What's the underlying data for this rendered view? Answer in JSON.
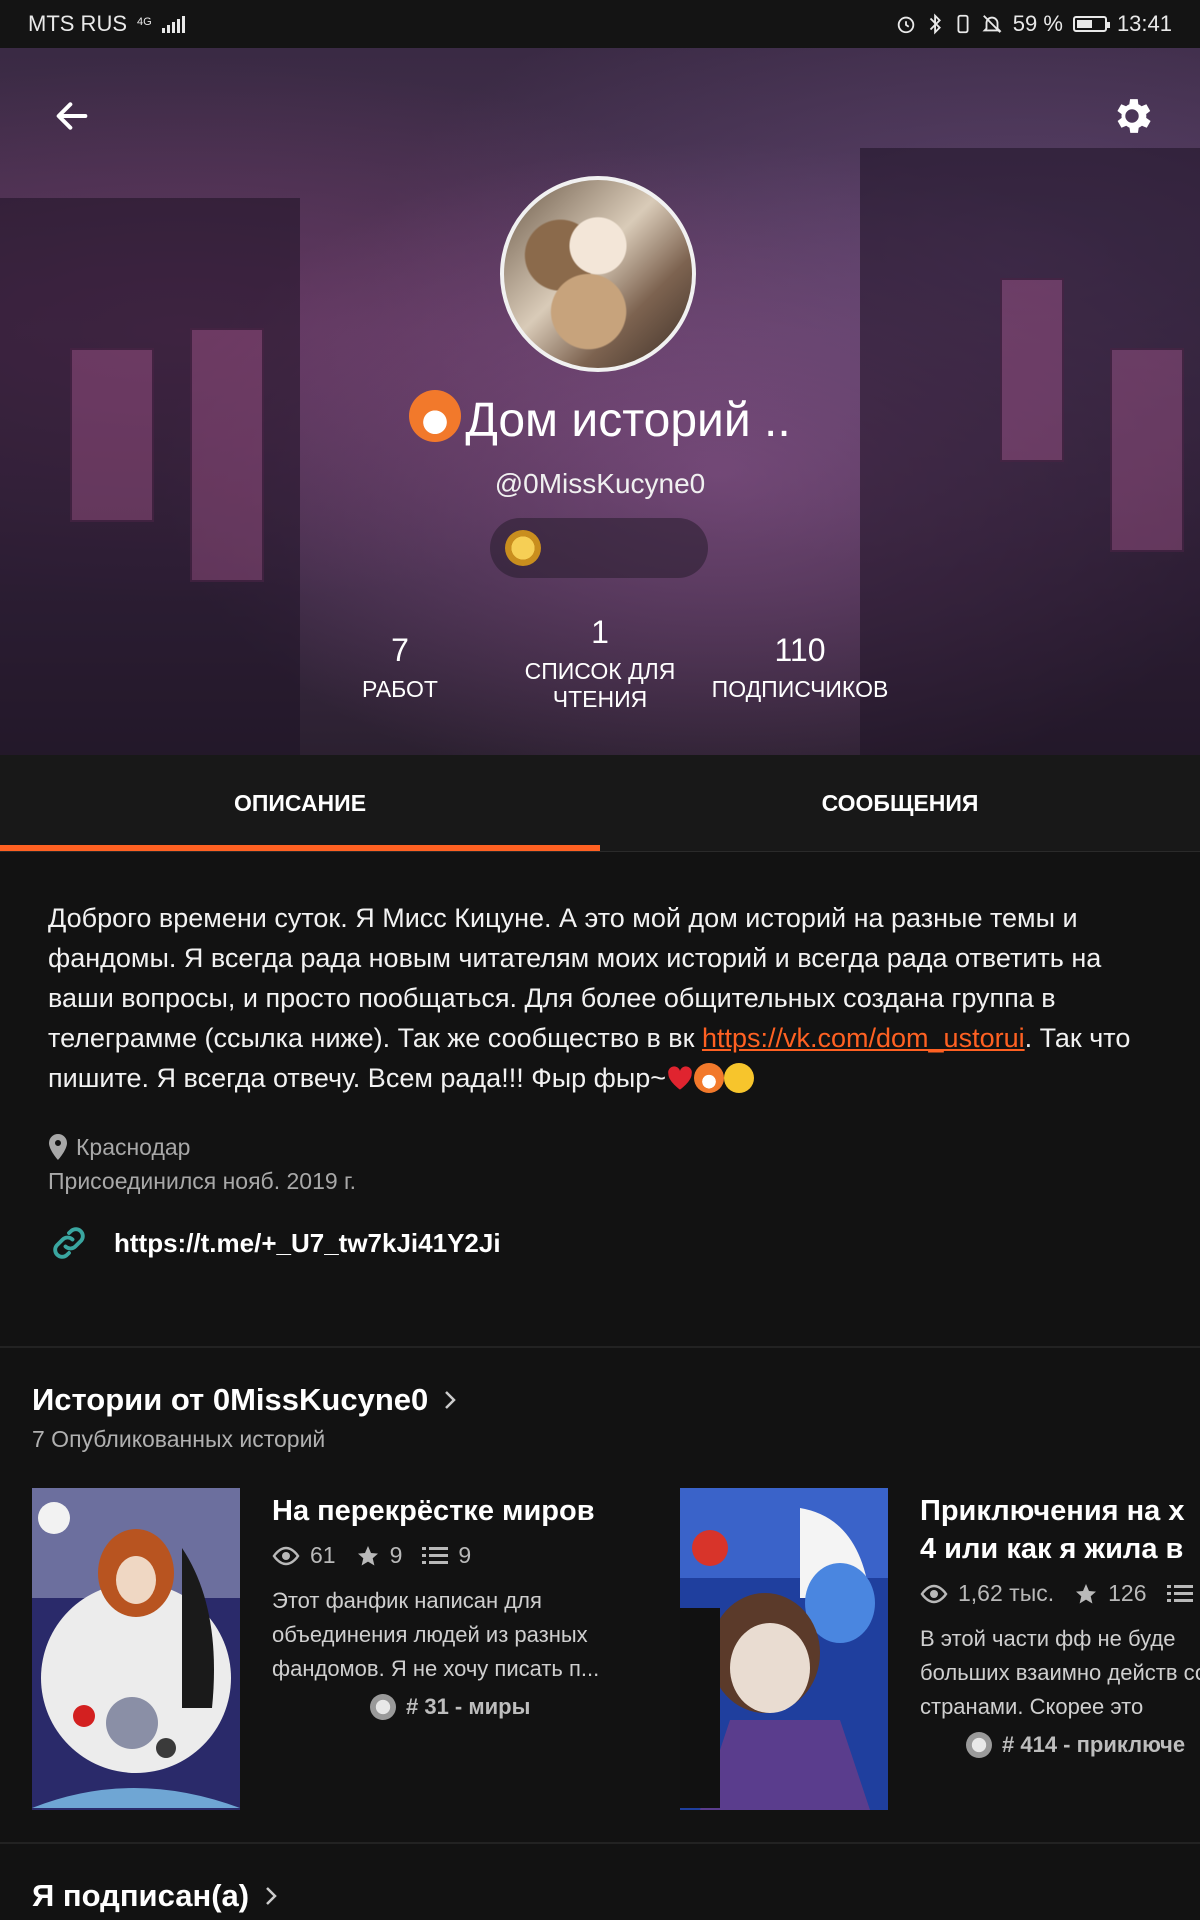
{
  "status_bar": {
    "carrier": "MTS RUS",
    "network": "4G",
    "battery": "59 %",
    "battery_level": 0.59,
    "time": "13:41"
  },
  "profile": {
    "display_name": "Дом историй ..",
    "username": "@0MissKucyne0",
    "stats": [
      {
        "value": "7",
        "label": "РАБОТ"
      },
      {
        "value": "1",
        "label": "СПИСОК ДЛЯ ЧТЕНИЯ"
      },
      {
        "value": "110",
        "label": "ПОДПИСЧИКОВ"
      }
    ]
  },
  "tabs": [
    {
      "label": "ОПИСАНИЕ",
      "active": true
    },
    {
      "label": "СООБЩЕНИЯ",
      "active": false
    }
  ],
  "about": {
    "text_before_link": "Доброго времени суток. Я Мисс Кицуне. А это мой дом историй на разные темы и фандомы. Я всегда рада новым читателям моих историй и всегда рада ответить на ваши вопросы, и просто пообщаться. Для более общительных создана группа в телеграмме (ссылка ниже). Так же сообщество в вк ",
    "link": "https://vk.com/dom_ustorui",
    "text_after_link": ". Так что пишите. Я всегда отвечу. Всем рада!!! Фыр фыр~",
    "location": "Краснодар",
    "joined": "Присоединился нояб. 2019 г.",
    "external_link": "https://t.me/+_U7_tw7kJi41Y2Ji"
  },
  "stories_section": {
    "title": "Истории от 0MissKucyne0",
    "subtitle": "7 Опубликованных историй",
    "stories": [
      {
        "title": "На перекрёстке миров",
        "reads": "61",
        "votes": "9",
        "parts": "9",
        "description": "Этот фанфик написан для объединения людей из разных фандомов. Я не хочу писать п...",
        "rank": "# 31 - миры"
      },
      {
        "title_line1": "Приключения на  х",
        "title_line2": "4 или как я жила в",
        "reads": "1,62 тыс.",
        "votes": "126",
        "description": "В этой части фф не буде больших взаимно действ со странами. Скорее это",
        "rank": "# 414 - приключе"
      }
    ]
  },
  "following_section": {
    "title": "Я подписан(а)"
  },
  "colors": {
    "accent": "#ff6122",
    "link_icon": "#3aa6a0",
    "background": "#121212"
  }
}
